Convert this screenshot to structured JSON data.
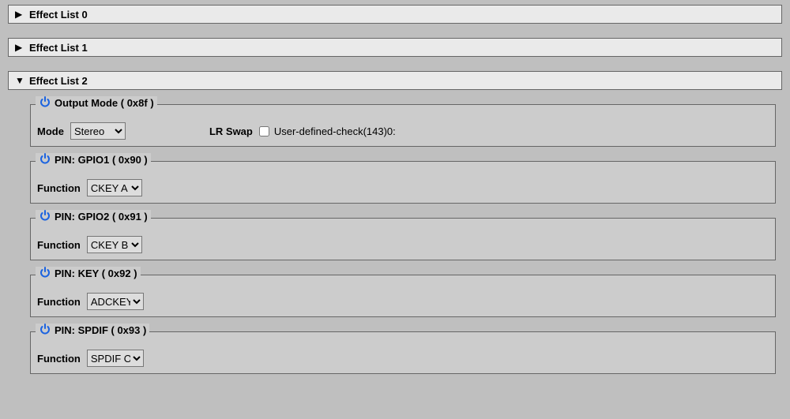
{
  "lists": {
    "l0": "Effect List 0",
    "l1": "Effect List 1",
    "l2": "Effect List 2"
  },
  "box1": {
    "title": "Output Mode ( 0x8f )",
    "field_label": "Mode",
    "select_value": "Stereo",
    "swap_label": "LR Swap",
    "user_label": "User-defined-check(143)0:"
  },
  "box2": {
    "title": "PIN: GPIO1 ( 0x90 )",
    "field_label": "Function",
    "select_value": "CKEY A"
  },
  "box3": {
    "title": "PIN: GPIO2 ( 0x91 )",
    "field_label": "Function",
    "select_value": "CKEY B"
  },
  "box4": {
    "title": "PIN: KEY ( 0x92 )",
    "field_label": "Function",
    "select_value": "ADCKEY"
  },
  "box5": {
    "title": "PIN: SPDIF ( 0x93 )",
    "field_label": "Function",
    "select_value": "SPDIF O"
  }
}
